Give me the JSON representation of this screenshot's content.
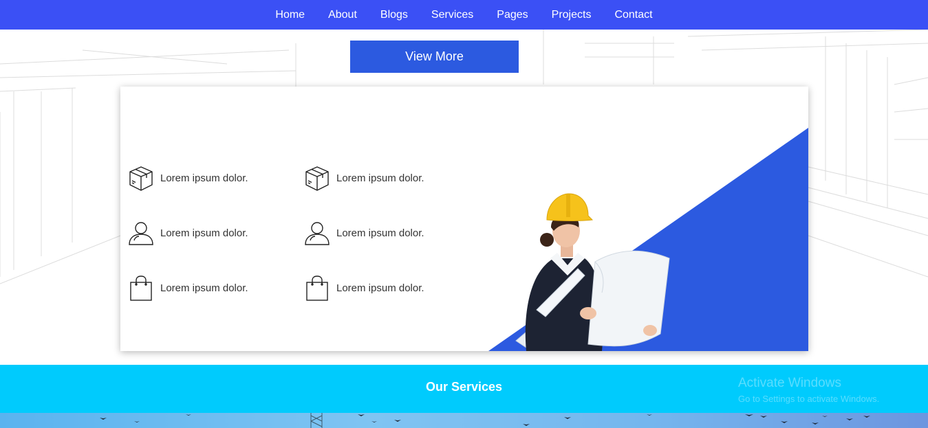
{
  "nav": {
    "items": [
      "Home",
      "About",
      "Blogs",
      "Services",
      "Pages",
      "Projects",
      "Contact"
    ]
  },
  "hero": {
    "view_more_label": "View More"
  },
  "features": {
    "col1": [
      {
        "icon": "box-icon",
        "text": "Lorem ipsum dolor."
      },
      {
        "icon": "user-icon",
        "text": "Lorem ipsum dolor."
      },
      {
        "icon": "shopping-bag-icon",
        "text": "Lorem ipsum dolor."
      }
    ],
    "col2": [
      {
        "icon": "box-icon",
        "text": "Lorem ipsum dolor."
      },
      {
        "icon": "user-icon",
        "text": "Lorem ipsum dolor."
      },
      {
        "icon": "shopping-bag-icon",
        "text": "Lorem ipsum dolor."
      }
    ]
  },
  "services": {
    "title": "Our Services"
  },
  "watermark": {
    "title": "Activate Windows",
    "subtitle": "Go to Settings to activate Windows."
  },
  "colors": {
    "nav_bg": "#3b50f5",
    "button_bg": "#2c5ae0",
    "accent_triangle": "#2c5ae0",
    "services_bg": "#00cbfd"
  }
}
